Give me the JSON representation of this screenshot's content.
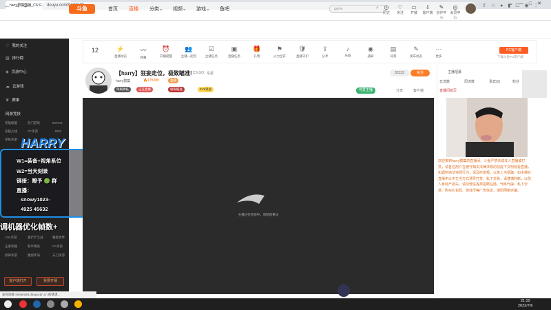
{
  "browser": {
    "tab_title": "harry群集直播_CS:GO直播_斗鱼",
    "url": "douyu.com/9407595"
  },
  "header": {
    "logo": "斗鱼",
    "nav": [
      "首页",
      "直播",
      "分类",
      "视频",
      "游戏",
      "鱼吧"
    ],
    "active_nav": "直播",
    "search_placeholder": "game",
    "icons": [
      {
        "label": "历史",
        "icon": "clock-icon"
      },
      {
        "label": "关注",
        "icon": "heart-icon"
      },
      {
        "label": "开播",
        "icon": "camera-icon"
      },
      {
        "label": "客户端",
        "icon": "download-icon"
      },
      {
        "label": "创作中心",
        "icon": "edit-icon"
      },
      {
        "label": "会员中心",
        "icon": "vip-icon"
      }
    ]
  },
  "sidebar": {
    "items": [
      {
        "label": "我的关注",
        "icon": "heart-icon"
      },
      {
        "label": "排行榜",
        "icon": "rank-icon"
      },
      {
        "label": "页游中心",
        "icon": "game-icon"
      },
      {
        "label": "云游戏",
        "icon": "cloud-icon"
      },
      {
        "label": "赛事",
        "icon": "trophy-icon"
      }
    ],
    "section_title": "网游竞技",
    "games_row1": [
      "英雄联盟",
      "热门游戏",
      "DOTA2"
    ],
    "games_row2": [
      "穿越火线",
      "CF手游",
      "DNF"
    ],
    "mobile_title": "单机热游",
    "lower_rows": [
      [
        "LOL手游",
        "金铲铲之战",
        "魔兽世界"
      ],
      [
        "王者荣耀",
        "和平精英",
        "CF手游"
      ],
      [
        "原神手游",
        "魔兽怀旧",
        "天刀手游"
      ]
    ],
    "btn_client": "客户端打开",
    "btn_live": "我要开播"
  },
  "overlay": {
    "brand": "HARRY",
    "lines": [
      "W1=装备+视角系位",
      "W2=当天刻录",
      "链接：瞭予 🟢 群",
      "直播：",
      "snowy1023-",
      "4925 45632"
    ],
    "tip": "调机器优化帧数+"
  },
  "giftbar": {
    "count": "12",
    "items": [
      "直播动态",
      "弹幕",
      "开播提醒",
      "主播一起玩",
      "主播任务",
      "直播任务",
      "礼物",
      "火力全开",
      "直播守护",
      "分享",
      "乐器",
      "通知",
      "背景",
      "发布动态",
      "更多"
    ],
    "pc_button": "PC客户端",
    "pc_sub": "下载斗鱼PC客户端"
  },
  "room": {
    "title": "【harry】狂妄走位，极致瞄准!",
    "category": "CS:GO",
    "report": "举报",
    "streamer": "harry群集",
    "hot": "175289",
    "tags": [
      "直播",
      "单刷神技",
      "正在直播",
      "极限瞄准"
    ],
    "rank": "13",
    "fans": "32123",
    "follow": "关注",
    "share": "分享",
    "client": "客户端",
    "sub_tag": "5V5对战",
    "like": "可爱主播"
  },
  "player": {
    "message": "主播正在连线中，请稍后重试"
  },
  "right_panel": {
    "tabs": [
      "日流数",
      "周流数",
      "贵宾(0)",
      "粉丝"
    ],
    "header": "主播招募",
    "link": "直播间首页",
    "chat": "欢迎来到harry群集的直播间。斗鱼严禁未成年人直播或打赏，请各位用户在遵守相关法律法规的前提下文明观看直播，如遇到违法违规行为，请及时举报，以免上当受骗。如主播在直播中以不正当方式诱导打赏，私下交易，请谨慎判断，以防人身财产损失。请勿轻信各类招聘征婚、代练代抽、私下交易、购买礼包码、游戏币等广告信息，谨防网络诈骗。"
  },
  "status_text": "正在连接 streamdst.douyucdn.cn 的请求...",
  "clock": {
    "time": "21:10",
    "date": "2022/7/6"
  }
}
